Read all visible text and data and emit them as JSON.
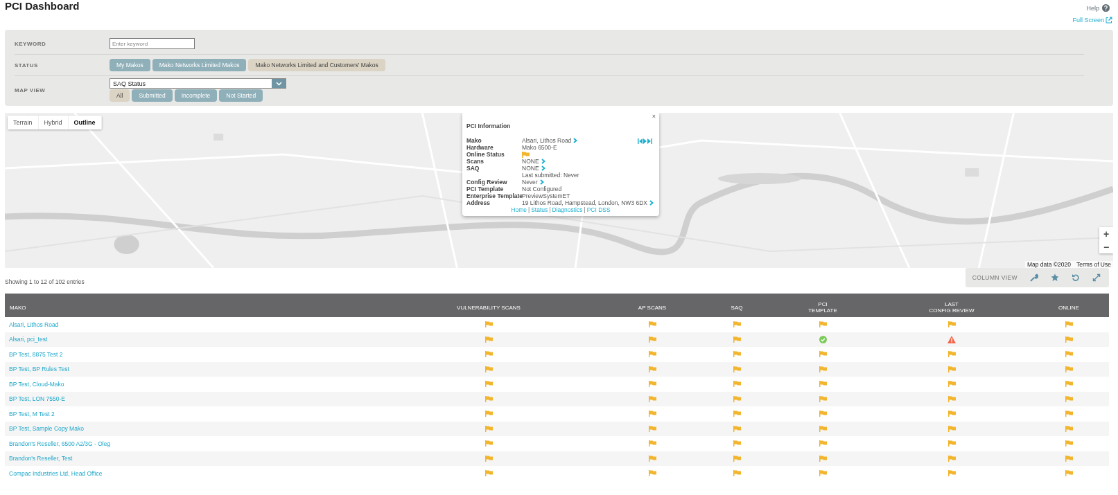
{
  "page": {
    "title": "PCI Dashboard",
    "help": "Help",
    "full_screen": "Full Screen"
  },
  "filters": {
    "keyword": {
      "label": "KEYWORD",
      "placeholder": "Enter keyword"
    },
    "status": {
      "label": "STATUS",
      "options": [
        {
          "label": "My Makos",
          "selected": false
        },
        {
          "label": "Mako Networks Limited Makos",
          "selected": false
        },
        {
          "label": "Mako Networks Limited and Customers' Makos",
          "selected": true
        }
      ]
    },
    "map_view": {
      "label": "MAP VIEW",
      "select": {
        "value": "SAQ Status"
      },
      "options": [
        {
          "label": "All",
          "selected": true
        },
        {
          "label": "Submitted",
          "selected": false
        },
        {
          "label": "Incomplete",
          "selected": false
        },
        {
          "label": "Not Started",
          "selected": false
        }
      ]
    }
  },
  "map": {
    "kind": "picture",
    "map_types": [
      {
        "label": "Terrain",
        "selected": false
      },
      {
        "label": "Hybrid",
        "selected": false
      },
      {
        "label": "Outline",
        "selected": true
      }
    ],
    "popup": {
      "title": "PCI Information",
      "fields": [
        {
          "label": "Mako",
          "value": "Alsari, Lithos Road",
          "link": true
        },
        {
          "label": "Hardware",
          "value": "Mako 6500-E",
          "link": false
        },
        {
          "label": "Online Status",
          "kind": "flag",
          "link": false
        },
        {
          "label": "Scans",
          "value": "NONE",
          "link": true
        },
        {
          "label": "SAQ",
          "value": "NONE",
          "link": true
        },
        {
          "value": "Last submitted: Never",
          "link": false
        },
        {
          "label": "Config Review",
          "value": "Never",
          "link": true
        },
        {
          "label": "PCI Template",
          "value": "Not Configured",
          "link": false
        },
        {
          "label": "Enterprise Template",
          "value": "PreviewSystemET",
          "link": false
        },
        {
          "label": "Address",
          "value": "19 Lithos Road, Hampstead, London, NW3 6DX",
          "link": true
        }
      ],
      "links": [
        "Home",
        "Status",
        "Diagnostics",
        "PCI DSS"
      ],
      "separator": "|",
      "close": "×"
    },
    "zoom": [
      "+",
      "−"
    ],
    "attribution": "Map data ©2020",
    "terms": "Terms of Use"
  },
  "summary": "Showing 1 to 12 of 102 entries",
  "column_view": {
    "label": "COLUMN VIEW"
  },
  "table": {
    "columns": [
      "MAKO",
      "VULNERABILITY SCANS",
      "AP SCANS",
      "SAQ",
      "PCI\nTEMPLATE",
      "LAST\nCONFIG REVIEW",
      "ONLINE"
    ],
    "rows": [
      {
        "mako": "Alsari, Lithos Road",
        "cells": [
          {
            "kind": "flag"
          },
          {
            "kind": "flag"
          },
          {
            "kind": "flag"
          },
          {
            "kind": "flag"
          },
          {
            "kind": "flag"
          },
          {
            "kind": "flag"
          }
        ]
      },
      {
        "mako": "Alsari, pci_test",
        "cells": [
          {
            "kind": "flag"
          },
          {
            "kind": "flag"
          },
          {
            "kind": "flag"
          },
          {
            "kind": "check"
          },
          {
            "kind": "warning"
          },
          {
            "kind": "flag"
          }
        ]
      },
      {
        "mako": "BP Test, 8875 Test 2",
        "cells": [
          {
            "kind": "flag"
          },
          {
            "kind": "flag"
          },
          {
            "kind": "flag"
          },
          {
            "kind": "flag"
          },
          {
            "kind": "flag"
          },
          {
            "kind": "flag"
          }
        ]
      },
      {
        "mako": "BP Test, BP Rules Test",
        "cells": [
          {
            "kind": "flag"
          },
          {
            "kind": "flag"
          },
          {
            "kind": "flag"
          },
          {
            "kind": "flag"
          },
          {
            "kind": "flag"
          },
          {
            "kind": "flag"
          }
        ]
      },
      {
        "mako": "BP Test, Cloud-Mako",
        "cells": [
          {
            "kind": "flag"
          },
          {
            "kind": "flag"
          },
          {
            "kind": "flag"
          },
          {
            "kind": "flag"
          },
          {
            "kind": "flag"
          },
          {
            "kind": "flag"
          }
        ]
      },
      {
        "mako": "BP Test, LON 7550-E",
        "cells": [
          {
            "kind": "flag"
          },
          {
            "kind": "flag"
          },
          {
            "kind": "flag"
          },
          {
            "kind": "flag"
          },
          {
            "kind": "flag"
          },
          {
            "kind": "flag"
          }
        ]
      },
      {
        "mako": "BP Test, M Test 2",
        "cells": [
          {
            "kind": "flag"
          },
          {
            "kind": "flag"
          },
          {
            "kind": "flag"
          },
          {
            "kind": "flag"
          },
          {
            "kind": "flag"
          },
          {
            "kind": "flag"
          }
        ]
      },
      {
        "mako": "BP Test, Sample Copy Mako",
        "cells": [
          {
            "kind": "flag"
          },
          {
            "kind": "flag"
          },
          {
            "kind": "flag"
          },
          {
            "kind": "flag"
          },
          {
            "kind": "flag"
          },
          {
            "kind": "flag"
          }
        ]
      },
      {
        "mako": "Brandon's Reseller, 6500 A2/3G - Oleg",
        "cells": [
          {
            "kind": "flag"
          },
          {
            "kind": "flag"
          },
          {
            "kind": "flag"
          },
          {
            "kind": "flag"
          },
          {
            "kind": "flag"
          },
          {
            "kind": "flag"
          }
        ]
      },
      {
        "mako": "Brandon's Reseller, Test",
        "cells": [
          {
            "kind": "flag"
          },
          {
            "kind": "flag"
          },
          {
            "kind": "flag"
          },
          {
            "kind": "flag"
          },
          {
            "kind": "flag"
          },
          {
            "kind": "flag"
          }
        ]
      },
      {
        "mako": "Compac Industries Ltd, Head Office",
        "cells": [
          {
            "kind": "flag"
          },
          {
            "kind": "flag"
          },
          {
            "kind": "flag"
          },
          {
            "kind": "flag"
          },
          {
            "kind": "flag"
          },
          {
            "kind": "flag"
          }
        ]
      }
    ]
  }
}
